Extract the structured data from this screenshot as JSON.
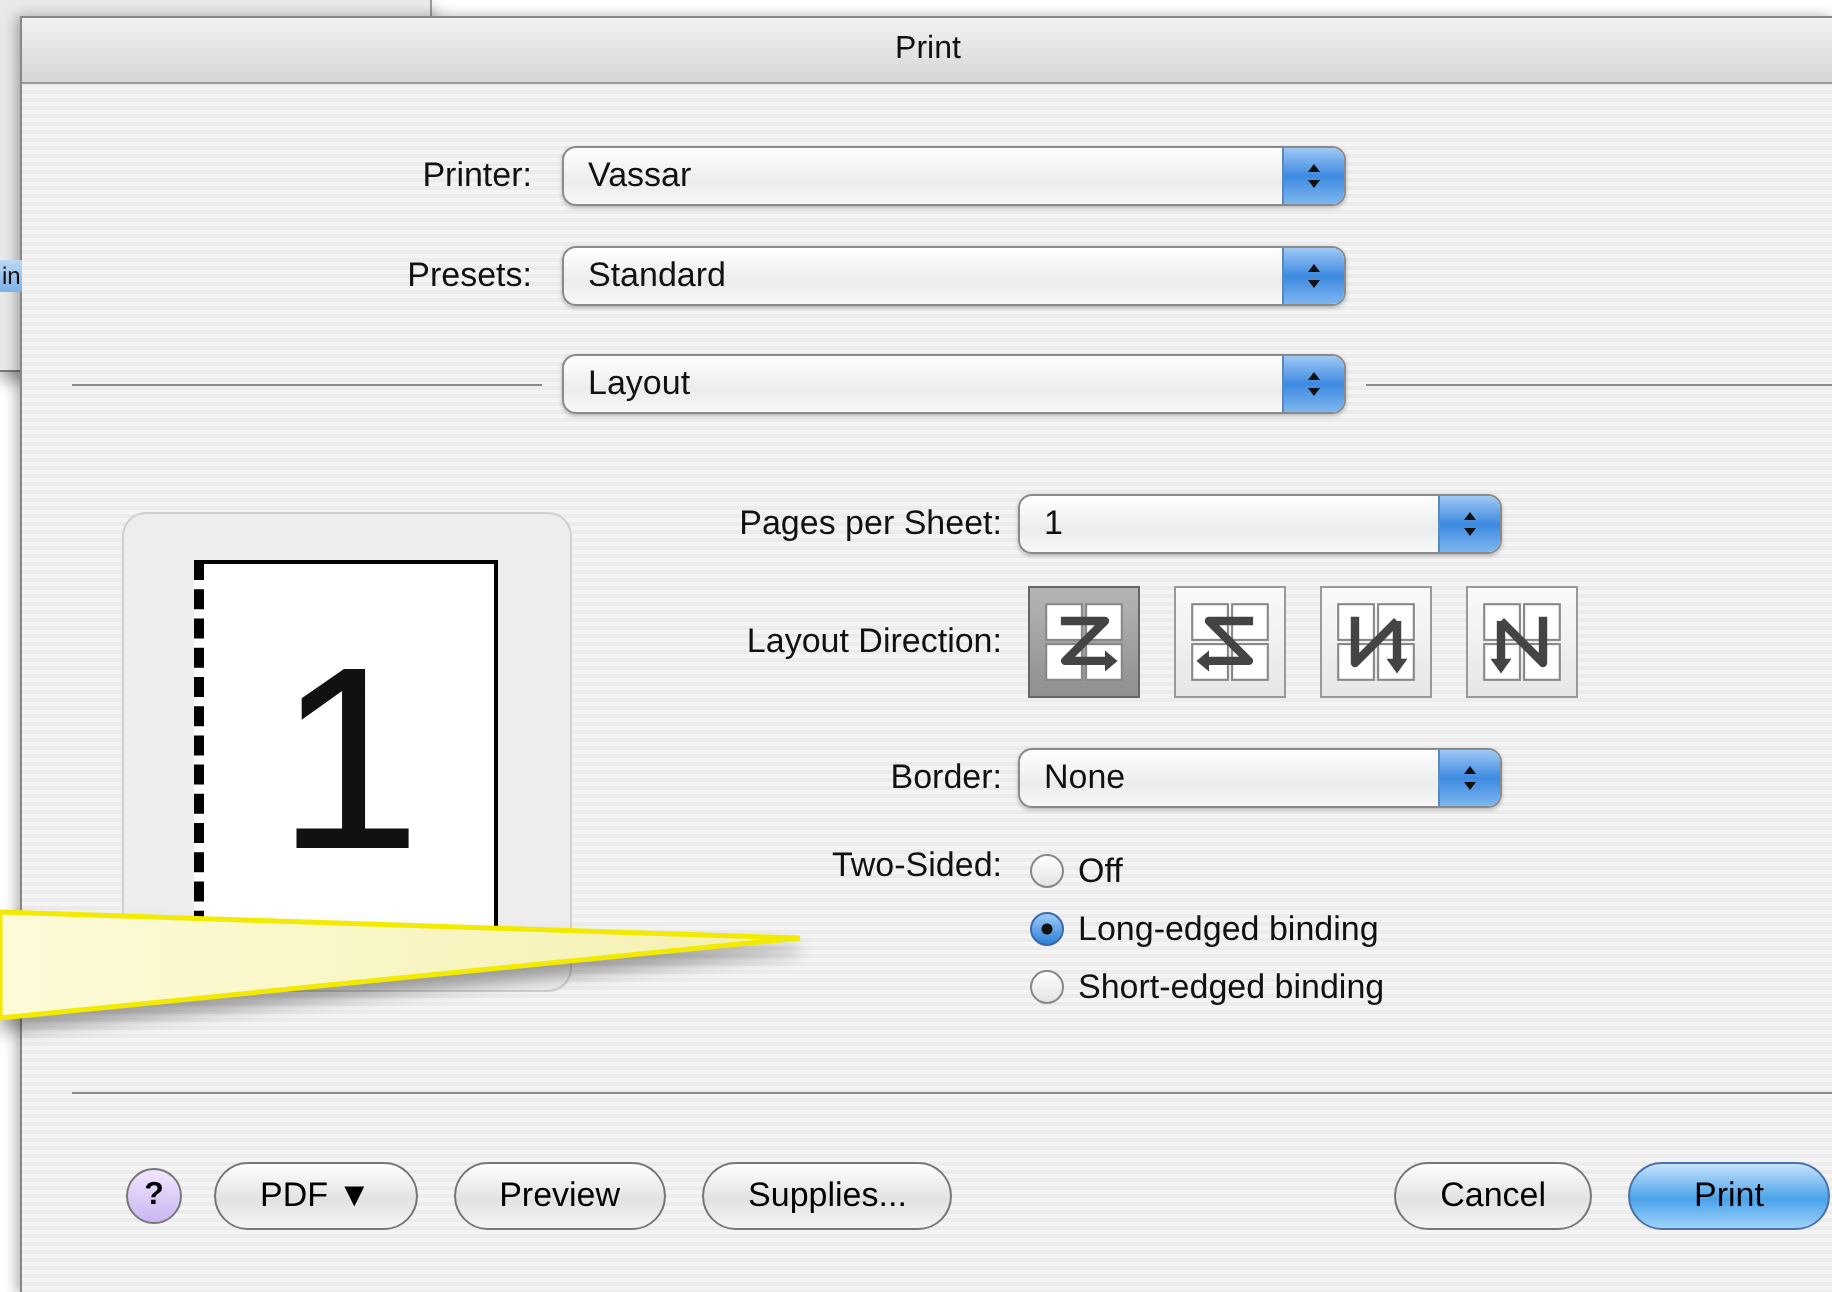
{
  "background_window": {
    "button": "in"
  },
  "dialog": {
    "title": "Print",
    "printer": {
      "label": "Printer:",
      "value": "Vassar"
    },
    "presets": {
      "label": "Presets:",
      "value": "Standard"
    },
    "pane": {
      "value": "Layout"
    },
    "preview": {
      "page_number": "1"
    },
    "pages_per_sheet": {
      "label": "Pages per Sheet:",
      "value": "1"
    },
    "layout_direction": {
      "label": "Layout Direction:",
      "options": [
        {
          "kind": "z",
          "selected": true
        },
        {
          "kind": "s",
          "selected": false
        },
        {
          "kind": "u",
          "selected": false
        },
        {
          "kind": "n",
          "selected": false
        }
      ]
    },
    "border": {
      "label": "Border:",
      "value": "None"
    },
    "two_sided": {
      "label": "Two-Sided:",
      "options": [
        {
          "label": "Off",
          "selected": false
        },
        {
          "label": "Long-edged binding",
          "selected": true
        },
        {
          "label": "Short-edged binding",
          "selected": false
        }
      ]
    },
    "left_buttons": [
      {
        "kind": "help",
        "label": "?"
      },
      {
        "kind": "plain",
        "label": "PDF ▼"
      },
      {
        "kind": "plain",
        "label": "Preview"
      },
      {
        "kind": "plain",
        "label": "Supplies..."
      }
    ],
    "right_buttons": [
      {
        "kind": "plain",
        "label": "Cancel"
      },
      {
        "kind": "default",
        "label": "Print"
      }
    ]
  }
}
